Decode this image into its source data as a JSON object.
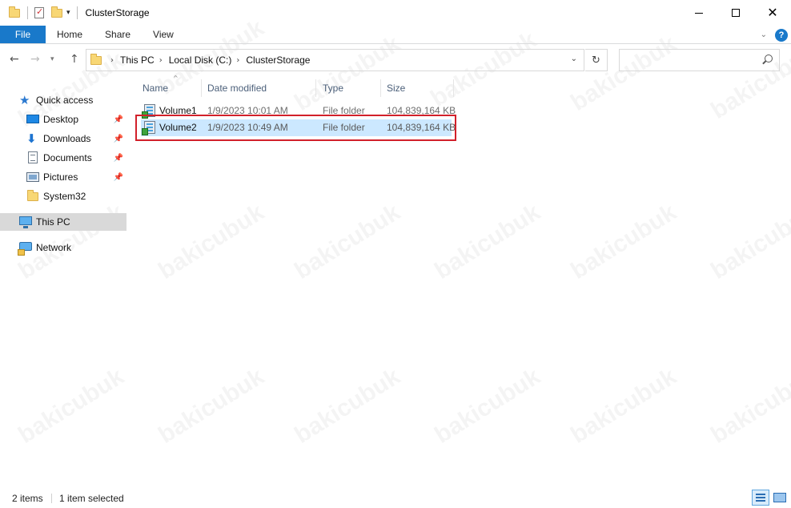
{
  "window": {
    "title": "ClusterStorage"
  },
  "ribbon": {
    "tabs": [
      {
        "label": "File"
      },
      {
        "label": "Home"
      },
      {
        "label": "Share"
      },
      {
        "label": "View"
      }
    ]
  },
  "address": {
    "crumbs": [
      "This PC",
      "Local Disk (C:)",
      "ClusterStorage"
    ]
  },
  "search": {
    "placeholder": ""
  },
  "nav_pane": {
    "quick_access": "Quick access",
    "items": [
      {
        "label": "Desktop",
        "pinned": true
      },
      {
        "label": "Downloads",
        "pinned": true
      },
      {
        "label": "Documents",
        "pinned": true
      },
      {
        "label": "Pictures",
        "pinned": true
      },
      {
        "label": "System32",
        "pinned": false
      }
    ],
    "this_pc": "This PC",
    "network": "Network"
  },
  "file_list": {
    "columns": [
      "Name",
      "Date modified",
      "Type",
      "Size"
    ],
    "rows": [
      {
        "name": "Volume1",
        "date": "1/9/2023 10:01 AM",
        "type": "File folder",
        "size": "104,839,164 KB",
        "selected": false
      },
      {
        "name": "Volume2",
        "date": "1/9/2023 10:49 AM",
        "type": "File folder",
        "size": "104,839,164 KB",
        "selected": true
      }
    ]
  },
  "status": {
    "item_count": "2 items",
    "selection": "1 item selected"
  },
  "watermark": "bakicubuk",
  "colors": {
    "accent": "#1979ca",
    "selection": "#cce8ff",
    "highlight_border": "#d2202a"
  }
}
